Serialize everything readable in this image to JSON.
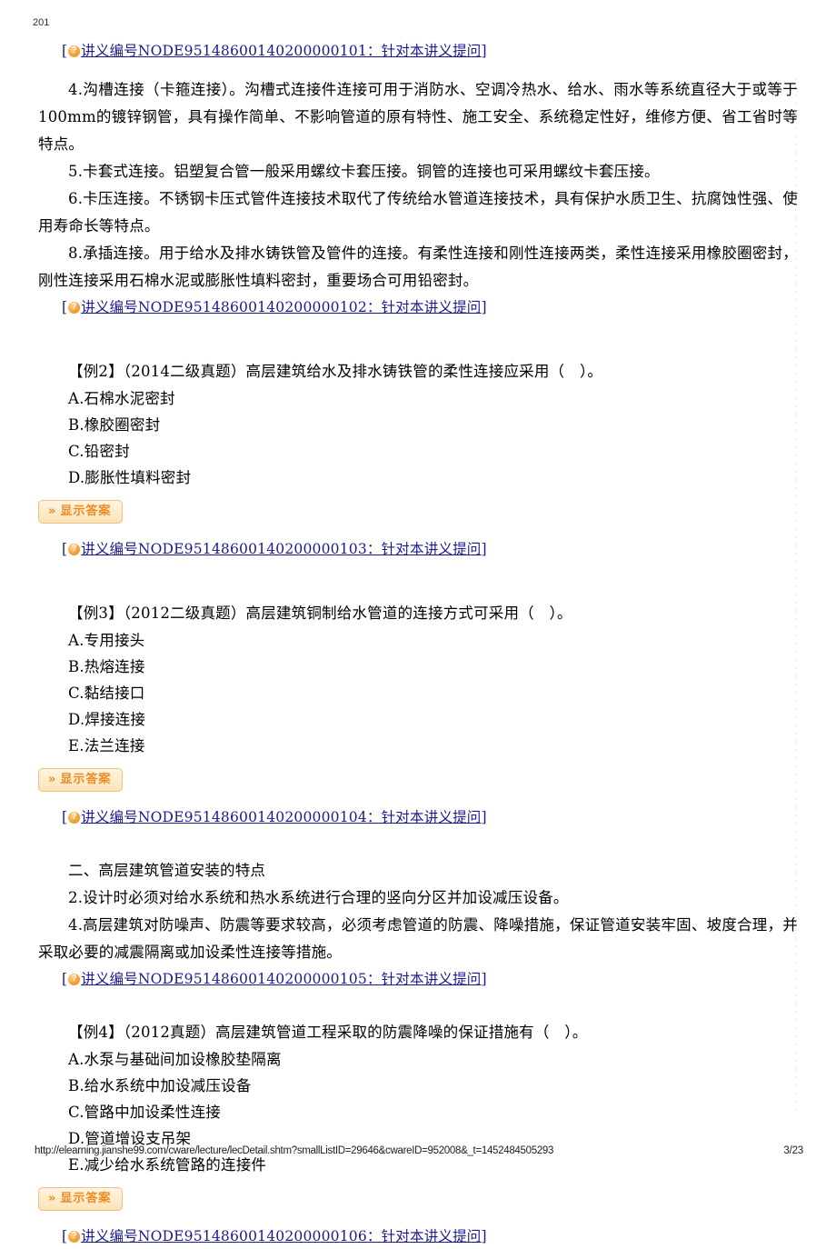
{
  "page": {
    "corner_stamp": "201",
    "footer_url": "http://elearning.jianshe99.com/cware/lecture/lecDetail.shtm?smallListID=29646&cwareID=952008&_t=1452484505293",
    "footer_pageno": "3/23"
  },
  "icons": {
    "help": "help-question-icon",
    "chevron": "»"
  },
  "labels": {
    "show_answer": "显示答案",
    "bracket_open": "[",
    "bracket_close": "]"
  },
  "lecture_refs": {
    "ref1": "讲义编号NODE95148600140200000101：针对本讲义提问",
    "ref2": "讲义编号NODE95148600140200000102：针对本讲义提问",
    "ref3": "讲义编号NODE95148600140200000103：针对本讲义提问",
    "ref4": "讲义编号NODE95148600140200000104：针对本讲义提问",
    "ref5": "讲义编号NODE95148600140200000105：针对本讲义提问",
    "ref6": "讲义编号NODE95148600140200000106：针对本讲义提问"
  },
  "body": {
    "p1": "4.沟槽连接（卡箍连接）。沟槽式连接件连接可用于消防水、空调冷热水、给水、雨水等系统直径大于或等于100mm的镀锌钢管，具有操作简单、不影响管道的原有特性、施工安全、系统稳定性好，维修方便、省工省时等特点。",
    "p2": "5.卡套式连接。铝塑复合管一般采用螺纹卡套压接。铜管的连接也可采用螺纹卡套压接。",
    "p3": "6.卡压连接。不锈钢卡压式管件连接技术取代了传统给水管道连接技术，具有保护水质卫生、抗腐蚀性强、使用寿命长等特点。",
    "p4": "8.承插连接。用于给水及排水铸铁管及管件的连接。有柔性连接和刚性连接两类，柔性连接采用橡胶圈密封，刚性连接采用石棉水泥或膨胀性填料密封，重要场合可用铅密封。",
    "section2_title": "二、高层建筑管道安装的特点",
    "s2_p1": "2.设计时必须对给水系统和热水系统进行合理的竖向分区并加设减压设备。",
    "s2_p2": "4.高层建筑对防噪声、防震等要求较高，必须考虑管道的防震、降噪措施，保证管道安装牢固、坡度合理，并采取必要的减震隔离或加设柔性连接等措施。"
  },
  "questions": [
    {
      "stem": "【例2】（2014二级真题）高层建筑给水及排水铸铁管的柔性连接应采用（　）。",
      "options": [
        "A.石棉水泥密封",
        "B.橡胶圈密封",
        "C.铅密封",
        "D.膨胀性填料密封"
      ]
    },
    {
      "stem": "【例3】（2012二级真题）高层建筑铜制给水管道的连接方式可采用（　）。",
      "options": [
        "A.专用接头",
        "B.热熔连接",
        "C.黏结接口",
        "D.焊接连接",
        "E.法兰连接"
      ]
    },
    {
      "stem": "【例4】（2012真题）高层建筑管道工程采取的防震降噪的保证措施有（　）。",
      "options": [
        "A.水泵与基础间加设橡胶垫隔离",
        "B.给水系统中加设减压设备",
        "C.管路中加设柔性连接",
        "D.管道增设支吊架",
        "E.减少给水系统管路的连接件"
      ]
    }
  ],
  "colors": {
    "link": "#1a1a8c",
    "button_text": "#ef8b22",
    "button_border": "#f0bf84",
    "icon_orange": "#f5a43c"
  }
}
